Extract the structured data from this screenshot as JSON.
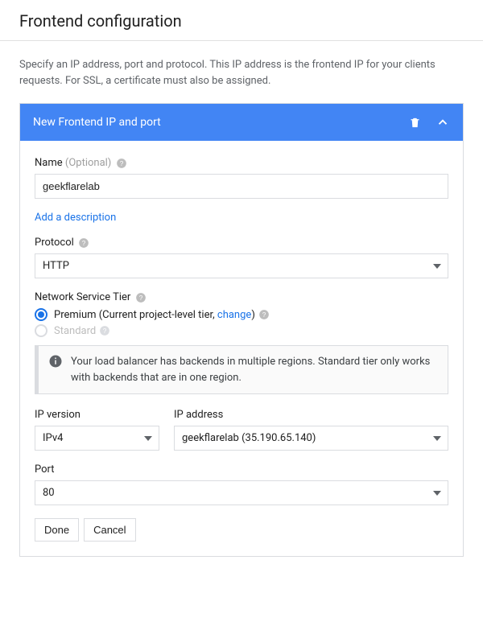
{
  "page": {
    "title": "Frontend configuration",
    "description": "Specify an IP address, port and protocol. This IP address is the frontend IP for your clients requests. For SSL, a certificate must also be assigned."
  },
  "card": {
    "title": "New Frontend IP and port",
    "fields": {
      "name": {
        "label": "Name",
        "optional": "(Optional)",
        "value": "geekflarelab"
      },
      "addDescriptionLink": "Add a description",
      "protocol": {
        "label": "Protocol",
        "value": "HTTP"
      },
      "networkTier": {
        "label": "Network Service Tier",
        "premium": {
          "prefix": "Premium (Current project-level tier, ",
          "link": "change",
          "suffix": ")"
        },
        "standard": "Standard",
        "info": "Your load balancer has backends in multiple regions. Standard tier only works with backends that are in one region."
      },
      "ipVersion": {
        "label": "IP version",
        "value": "IPv4"
      },
      "ipAddress": {
        "label": "IP address",
        "value": "geekflarelab (35.190.65.140)"
      },
      "port": {
        "label": "Port",
        "value": "80"
      }
    },
    "buttons": {
      "done": "Done",
      "cancel": "Cancel"
    }
  }
}
